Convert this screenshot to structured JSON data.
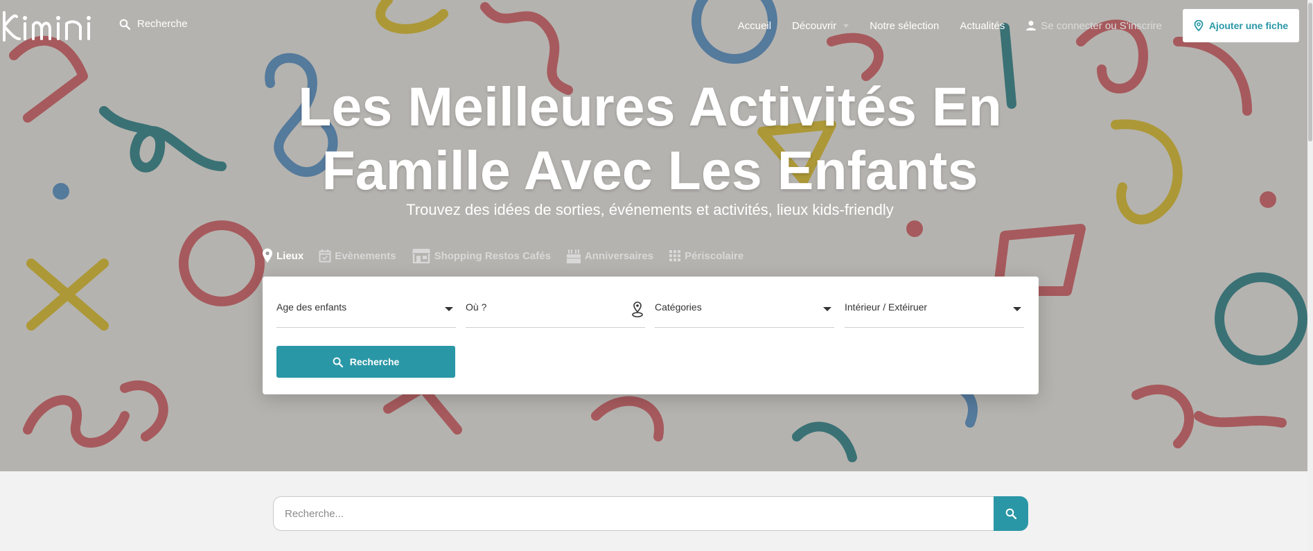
{
  "brand": {
    "logo_text": "Kimini"
  },
  "header": {
    "search_label": "Recherche",
    "nav": [
      {
        "label": "Accueil"
      },
      {
        "label": "Découvrir"
      },
      {
        "label": "Notre sélection"
      },
      {
        "label": "Actualités"
      }
    ],
    "login_label": "Se connecter ou S'inscrire",
    "add_button_label": "Ajouter une fiche"
  },
  "hero": {
    "title_line1": "Les Meilleures Activités En",
    "title_line2": "Famille Avec Les Enfants",
    "subtitle": "Trouvez des idées de sorties, événements et activités, lieux kids-friendly"
  },
  "tabs": [
    {
      "label": "Lieux",
      "icon": "map-pin-icon",
      "active": true
    },
    {
      "label": "Evènements",
      "icon": "calendar-icon",
      "active": false
    },
    {
      "label": "Shopping Restos Cafés",
      "icon": "store-icon",
      "active": false
    },
    {
      "label": "Anniversaires",
      "icon": "cake-icon",
      "active": false
    },
    {
      "label": "Périscolaire",
      "icon": "grid-icon",
      "active": false
    }
  ],
  "filters": {
    "age_label": "Age des enfants",
    "where_label": "Où ?",
    "categories_label": "Catégories",
    "indoor_label": "Intérieur / Extéiruer",
    "search_button_label": "Recherche"
  },
  "bottom_search": {
    "placeholder": "Recherche..."
  },
  "colors": {
    "accent": "#2a97a6",
    "hero_red": "#d9575c",
    "hero_blue": "#4d8ec9",
    "hero_yellow": "#e3c21b",
    "hero_teal": "#1f7f86"
  }
}
